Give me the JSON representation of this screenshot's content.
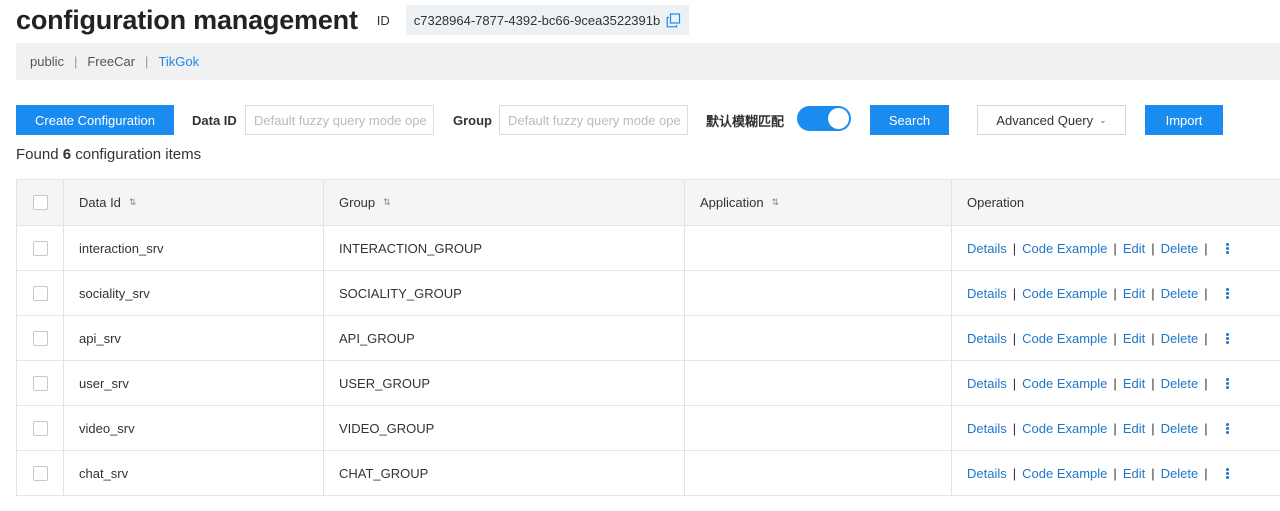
{
  "header": {
    "title": "configuration management",
    "id_label": "ID",
    "id_value": "c7328964-7877-4392-bc66-9cea3522391b"
  },
  "namespaces": [
    {
      "label": "public",
      "active": false
    },
    {
      "label": "FreeCar",
      "active": false
    },
    {
      "label": "TikGok",
      "active": true
    }
  ],
  "toolbar": {
    "create_label": "Create Configuration",
    "data_id_label": "Data ID",
    "data_id_placeholder": "Default fuzzy query mode ope",
    "group_label": "Group",
    "group_placeholder": "Default fuzzy query mode ope",
    "fuzzy_label": "默认模糊匹配",
    "fuzzy_on": true,
    "search_label": "Search",
    "advanced_label": "Advanced Query",
    "import_label": "Import"
  },
  "summary": {
    "prefix": "Found",
    "count": "6",
    "suffix": "configuration items"
  },
  "table": {
    "headers": {
      "data_id": "Data Id",
      "group": "Group",
      "application": "Application",
      "operation": "Operation"
    },
    "rows": [
      {
        "data_id": "interaction_srv",
        "group": "INTERACTION_GROUP",
        "application": ""
      },
      {
        "data_id": "sociality_srv",
        "group": "SOCIALITY_GROUP",
        "application": ""
      },
      {
        "data_id": "api_srv",
        "group": "API_GROUP",
        "application": ""
      },
      {
        "data_id": "user_srv",
        "group": "USER_GROUP",
        "application": ""
      },
      {
        "data_id": "video_srv",
        "group": "VIDEO_GROUP",
        "application": ""
      },
      {
        "data_id": "chat_srv",
        "group": "CHAT_GROUP",
        "application": ""
      }
    ],
    "operations": {
      "details": "Details",
      "code_example": "Code Example",
      "edit": "Edit",
      "delete": "Delete",
      "separator": "|"
    }
  },
  "colors": {
    "primary": "#1a8cf0",
    "link": "#1f76c8",
    "active_namespace": "#1f88e5"
  }
}
